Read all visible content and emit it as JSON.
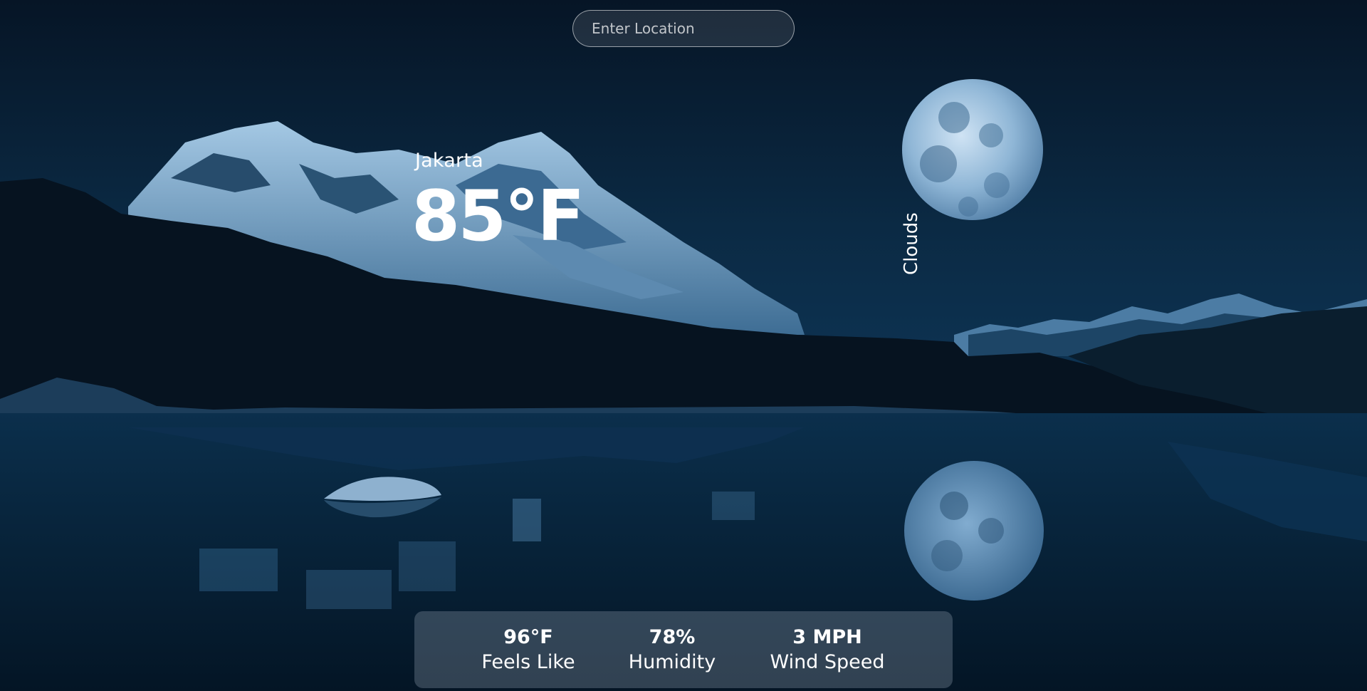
{
  "search": {
    "placeholder": "Enter Location",
    "value": ""
  },
  "weather": {
    "location": "Jakarta",
    "temperature": "85°F",
    "description": "Clouds"
  },
  "stats": [
    {
      "value": "96°F",
      "label": "Feels Like"
    },
    {
      "value": "78%",
      "label": "Humidity"
    },
    {
      "value": "3 MPH",
      "label": "Wind Speed"
    }
  ],
  "colors": {
    "sky_dark": "#061526",
    "sky_light": "#0d3350",
    "mountain_snow": "#8fb8d8",
    "forest": "#06121c",
    "water": "#07233a",
    "moon": "#9cc4e4",
    "panel": "rgba(155,170,185,0.30)"
  }
}
